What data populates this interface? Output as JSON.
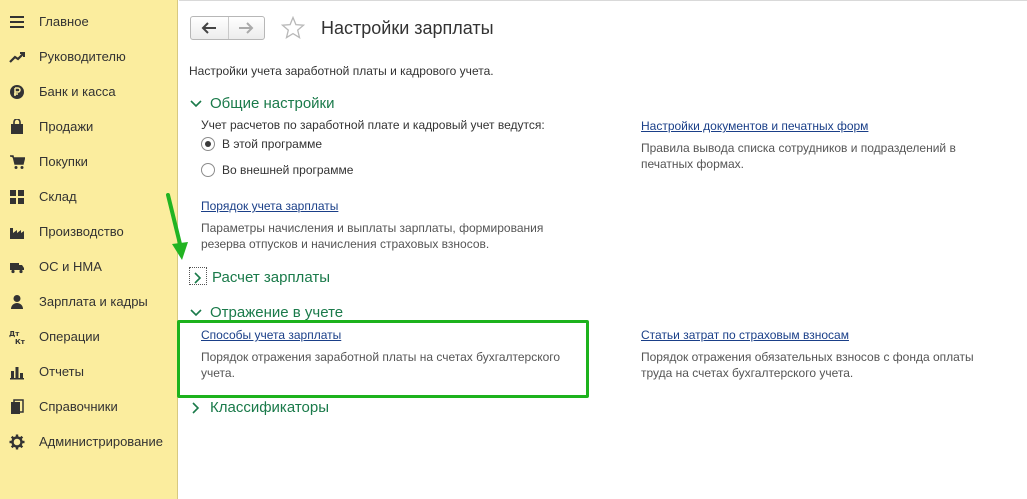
{
  "sidebar": {
    "items": [
      {
        "label": "Главное",
        "icon": "menu-lines-icon"
      },
      {
        "label": "Руководителю",
        "icon": "trend-up-icon"
      },
      {
        "label": "Банк и касса",
        "icon": "ruble-coin-icon"
      },
      {
        "label": "Продажи",
        "icon": "shopping-bag-icon"
      },
      {
        "label": "Покупки",
        "icon": "shopping-cart-icon"
      },
      {
        "label": "Склад",
        "icon": "warehouse-grid-icon"
      },
      {
        "label": "Производство",
        "icon": "factory-icon"
      },
      {
        "label": "ОС и НМА",
        "icon": "truck-icon"
      },
      {
        "label": "Зарплата и кадры",
        "icon": "person-icon"
      },
      {
        "label": "Операции",
        "icon": "dt-kt-icon"
      },
      {
        "label": "Отчеты",
        "icon": "bar-chart-icon"
      },
      {
        "label": "Справочники",
        "icon": "books-icon"
      },
      {
        "label": "Администрирование",
        "icon": "gear-icon"
      }
    ]
  },
  "header": {
    "title": "Настройки зарплаты"
  },
  "main": {
    "subtitle": "Настройки учета заработной платы и кадрового учета.",
    "general": {
      "title": "Общие настройки",
      "question": "Учет расчетов по заработной плате и кадровый учет ведутся:",
      "radio_options": [
        "В этой программе",
        "Во внешней программе"
      ],
      "selected": "В этой программе",
      "payroll_order_link": "Порядок учета зарплаты",
      "payroll_order_desc_1": "Параметры начисления и выплаты зарплаты, формирования",
      "payroll_order_desc_2": "резерва отпусков и начисления страховых взносов.",
      "docs_link": "Настройки документов и печатных форм",
      "docs_desc_1": "Правила вывода списка сотрудников и подразделений в",
      "docs_desc_2": "печатных формах."
    },
    "calc": {
      "title": "Расчет зарплаты"
    },
    "accounting": {
      "title": "Отражение в учете",
      "methods_link": "Способы учета зарплаты",
      "methods_desc_1": "Порядок отражения заработной платы на счетах бухгалтерского",
      "methods_desc_2": "учета.",
      "costs_link": "Статьи затрат по страховым взносам",
      "costs_desc_1": "Порядок отражения обязательных взносов с фонда оплаты",
      "costs_desc_2": "труда на счетах бухгалтерского учета."
    },
    "classifiers": {
      "title": "Классификаторы"
    }
  },
  "colors": {
    "sidebar_bg": "#fbed9e",
    "section_green": "#1a7a4a",
    "link_blue": "#1a3f88",
    "highlight_green": "#1db21d"
  }
}
